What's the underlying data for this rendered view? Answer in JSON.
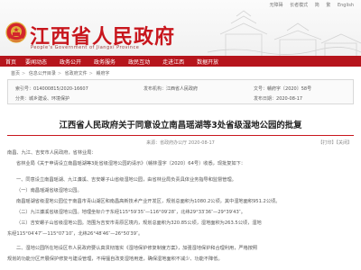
{
  "header": {
    "site_title": "江西省人民政府",
    "site_subtitle": "People's Government of Jiangxi Province",
    "top_links": [
      "无障碍",
      "长者模式",
      "简",
      "繁",
      "English"
    ]
  },
  "nav": {
    "items": [
      "首页",
      "要闻动态",
      "政务公开",
      "政务服务",
      "政民互动",
      "走进江西",
      "数据开放"
    ]
  },
  "breadcrumb": [
    "首页",
    "信息公开目录",
    "省政府文件",
    "赣府字"
  ],
  "info": {
    "index_label": "索引号：",
    "index_value": "014000815/2020-16607",
    "category_label": "分类：",
    "category_value": "城乡建设、环境保护",
    "publisher_label": "发布机构：",
    "publisher_value": "江西省人民政府",
    "doc_no_label": "文号：",
    "doc_no_value": "赣府字〔2020〕58号",
    "date_label": "发布日期：",
    "date_value": "2020-08-17"
  },
  "title": "江西省人民政府关于同意设立南昌瑶湖等3处省级湿地公园的批复",
  "meta": "来源：省政府办公厅  2020-08-17",
  "tools": "【打印】【关闭】",
  "paragraphs": [
    "南昌、九江、吉安市人民政府，省林业局：",
    "省林业局《关于申请设立南昌瑶湖等3处省级湿地公园的请示》（赣林湿字〔2020〕64号）收悉，现批复如下：",
    "一、同意设立南昌瑶湖、九江濂溪、吉安螺子山省级湿地公园，由省林业局负责具体业务指导和监督管理。",
    "（一）南昌瑶湖省级湿地公园。",
    "南昌瑶湖省级湿地公园位于南昌市青山湖区和南昌高新技术产业开发区，规划总面积为1080.2公顷，其中湿地面积951.2公顷。",
    "（二）九江濂溪省级湿地公园。地理坐标介于东经115°59′35″—116°09′28″，北纬29°33′36″—29°39′43″。",
    "（三）吉安螺子山省级湿地公园。范围为吉安市青原区境内，规划总面积为320.85公顷，湿地面积为263.5公顷，湿地",
    "东经115°04′47″—115°07′10″，北纬26°48′46″—26°50′39″。",
    "二、湿地公园所在地设区市人民政府要认真贯彻落实《湿地保护修复制度方案》，加强湿地保护和合理利用，严格按照",
    "规划的功能分区开展保护修复与建设管理，不得擅自改变湿地用途，确保湿地面积不减少、功能不降低。"
  ]
}
